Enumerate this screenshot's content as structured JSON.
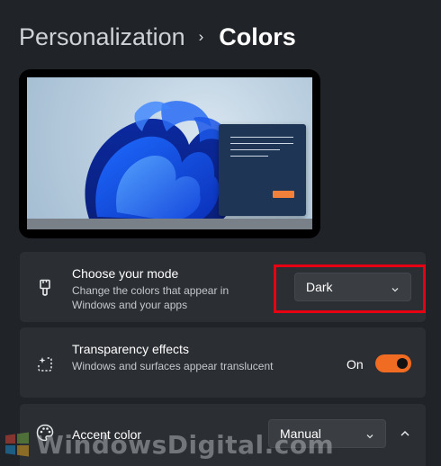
{
  "breadcrumb": {
    "parent": "Personalization",
    "separator": "›",
    "current": "Colors"
  },
  "preview": {
    "icons": {
      "wallpaper": "windows-11-bloom-wallpaper",
      "window": "sample-window"
    },
    "colors": {
      "window": "#1f3556",
      "window_button": "#f0803a"
    }
  },
  "mode_card": {
    "icon": "brush-icon",
    "title": "Choose your mode",
    "description": "Change the colors that appear in Windows and your apps",
    "dropdown_value": "Dark",
    "highlight_color": "#e60012"
  },
  "transparency_card": {
    "icon": "transparency-icon",
    "title": "Transparency effects",
    "description": "Windows and surfaces appear translucent",
    "toggle_label": "On",
    "toggle_on": true,
    "toggle_color": "#f06c22"
  },
  "accent_card": {
    "icon": "palette-icon",
    "title": "Accent color",
    "dropdown_value": "Manual",
    "expand_icon": "chevron-up-icon"
  },
  "watermark": {
    "text": "WindowsDigital.com",
    "logo_icon": "windows-logo-icon"
  }
}
